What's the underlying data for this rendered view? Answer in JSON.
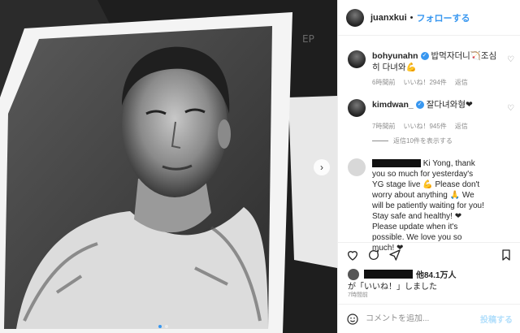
{
  "post": {
    "username": "juanxkui",
    "separator": "•",
    "follow_label": "フォローする",
    "more_icon": "ellipsis-icon"
  },
  "comments": [
    {
      "username": "bohyunahn",
      "verified": true,
      "text": "밥먹자더니🏹조심히 다녀와💪",
      "time": "6時間前",
      "likes": "いいね！294件",
      "reply": "返信"
    },
    {
      "username": "kimdwan_",
      "verified": true,
      "text": "잘다녀와형❤",
      "time": "7時間前",
      "likes": "いいね！945件",
      "reply": "返信"
    }
  ],
  "view_replies": "返信10件を表示する",
  "fan_comment": {
    "text": "Ki Yong, thank you so much for yesterday's YG stage live 💪 Please don't worry about anything 🙏 We will be patiently waiting for you! Stay safe and healthy! ❤ Please update when it's possible. We love you so much! ❤"
  },
  "footer": {
    "likes_count": "他84.1万人",
    "liked_by": "が「いいね！」しました",
    "time": "7時間前",
    "comment_placeholder": "コメントを追加...",
    "post_button": "投稿する"
  },
  "image": {
    "description_icon": "printer-photo"
  }
}
